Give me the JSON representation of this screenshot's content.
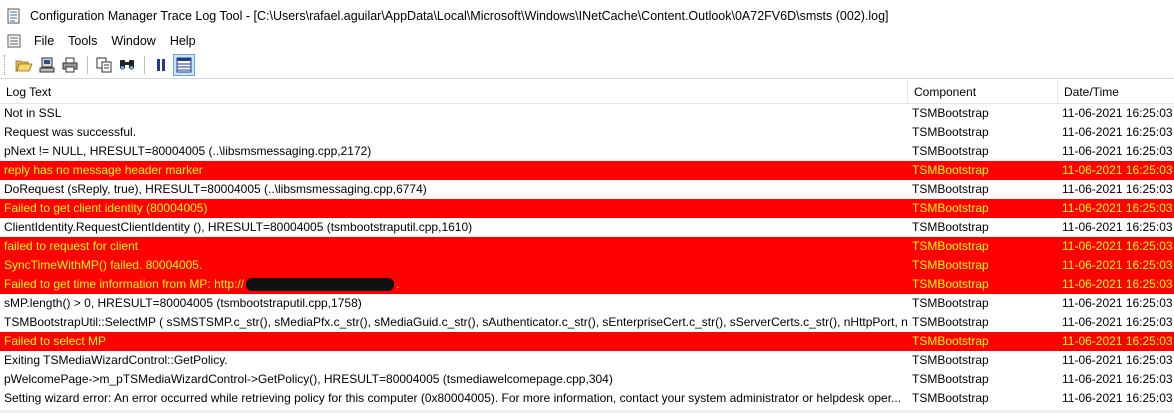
{
  "window": {
    "title": "Configuration Manager Trace Log Tool - [C:\\Users\\rafael.aguilar\\AppData\\Local\\Microsoft\\Windows\\INetCache\\Content.Outlook\\0A72FV6D\\smsts (002).log]"
  },
  "menu": {
    "items": [
      "File",
      "Tools",
      "Window",
      "Help"
    ]
  },
  "toolbar": {
    "buttons": [
      "open-icon",
      "server-icon",
      "print-icon",
      "copy-icon",
      "find-icon",
      "pause-icon",
      "grid-icon"
    ]
  },
  "columns": {
    "text": "Log Text",
    "component": "Component",
    "date": "Date/Time"
  },
  "colors": {
    "error_bg": "#ff0000",
    "error_fg": "#ffff00"
  },
  "rows": [
    {
      "text": "Not in SSL",
      "component": "TSMBootstrap",
      "date": "11-06-2021 16:25:03",
      "error": false
    },
    {
      "text": "Request was successful.",
      "component": "TSMBootstrap",
      "date": "11-06-2021 16:25:03",
      "error": false
    },
    {
      "text": "pNext != NULL, HRESULT=80004005 (..\\libsmsmessaging.cpp,2172)",
      "component": "TSMBootstrap",
      "date": "11-06-2021 16:25:03",
      "error": false
    },
    {
      "text": "reply has no message header marker",
      "component": "TSMBootstrap",
      "date": "11-06-2021 16:25:03",
      "error": true
    },
    {
      "text": "DoRequest (sReply, true), HRESULT=80004005 (..\\libsmsmessaging.cpp,6774)",
      "component": "TSMBootstrap",
      "date": "11-06-2021 16:25:03",
      "error": false
    },
    {
      "text": "Failed to get client identity (80004005)",
      "component": "TSMBootstrap",
      "date": "11-06-2021 16:25:03",
      "error": true
    },
    {
      "text": "ClientIdentity.RequestClientIdentity (), HRESULT=80004005 (tsmbootstraputil.cpp,1610)",
      "component": "TSMBootstrap",
      "date": "11-06-2021 16:25:03",
      "error": false
    },
    {
      "text": "failed to request for client",
      "component": "TSMBootstrap",
      "date": "11-06-2021 16:25:03",
      "error": true
    },
    {
      "text": "SyncTimeWithMP() failed. 80004005.",
      "component": "TSMBootstrap",
      "date": "11-06-2021 16:25:03",
      "error": true
    },
    {
      "text": "Failed to get time information from MP: http://",
      "suffix": ".",
      "redacted": true,
      "component": "TSMBootstrap",
      "date": "11-06-2021 16:25:03",
      "error": true
    },
    {
      "text": "sMP.length() > 0, HRESULT=80004005 (tsmbootstraputil.cpp,1758)",
      "component": "TSMBootstrap",
      "date": "11-06-2021 16:25:03",
      "error": false
    },
    {
      "text": "TSMBootstrapUtil::SelectMP ( sSMSTSMP.c_str(), sMediaPfx.c_str(), sMediaGuid.c_str(), sAuthenticator.c_str(), sEnterpriseCert.c_str(), sServerCerts.c_str(), nHttpPort, nHttp...",
      "component": "TSMBootstrap",
      "date": "11-06-2021 16:25:03",
      "error": false
    },
    {
      "text": "Failed to select MP",
      "component": "TSMBootstrap",
      "date": "11-06-2021 16:25:03",
      "error": true
    },
    {
      "text": "Exiting TSMediaWizardControl::GetPolicy.",
      "component": "TSMBootstrap",
      "date": "11-06-2021 16:25:03",
      "error": false
    },
    {
      "text": "pWelcomePage->m_pTSMediaWizardControl->GetPolicy(), HRESULT=80004005 (tsmediawelcomepage.cpp,304)",
      "component": "TSMBootstrap",
      "date": "11-06-2021 16:25:03",
      "error": false
    },
    {
      "text": "Setting wizard error: An error occurred while retrieving policy for this computer  (0x80004005). For more information, contact your system administrator or helpdesk oper...",
      "component": "TSMBootstrap",
      "date": "11-06-2021 16:25:03",
      "error": false
    }
  ]
}
